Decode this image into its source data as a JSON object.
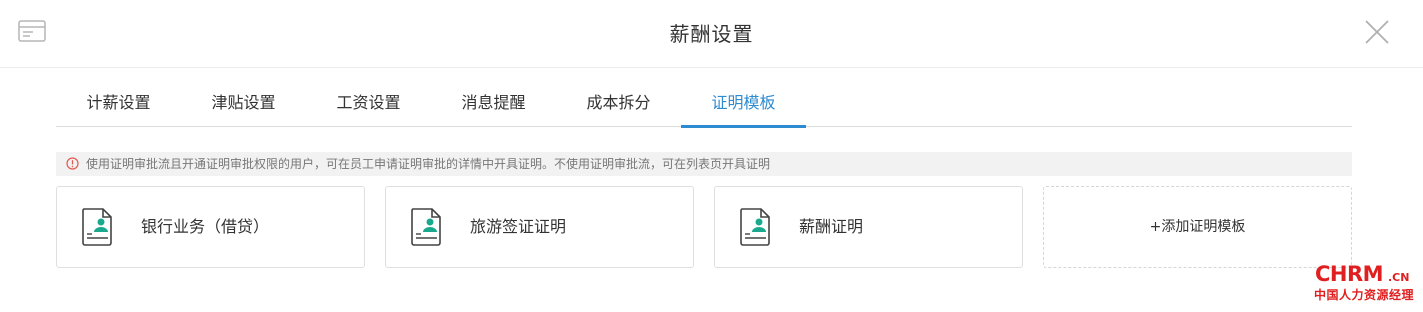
{
  "header": {
    "title": "薪酬设置",
    "left_icon": "card-icon",
    "close_icon": "close-icon"
  },
  "tabs": [
    {
      "label": "计薪设置"
    },
    {
      "label": "津贴设置"
    },
    {
      "label": "工资设置"
    },
    {
      "label": "消息提醒"
    },
    {
      "label": "成本拆分"
    },
    {
      "label": "证明模板",
      "active": true
    }
  ],
  "notice": {
    "icon": "info-icon",
    "text": "使用证明审批流且开通证明审批权限的用户，可在员工申请证明审批的详情中开具证明。不使用证明审批流，可在列表页开具证明"
  },
  "templates": [
    {
      "label": "银行业务（借贷）",
      "icon": "certificate-icon"
    },
    {
      "label": "旅游签证证明",
      "icon": "certificate-icon"
    },
    {
      "label": "薪酬证明",
      "icon": "certificate-icon"
    }
  ],
  "add_template_label": "+添加证明模板",
  "watermark": {
    "main": "CHRM",
    "suffix": ".CN",
    "sub": "中国人力资源经理"
  },
  "colors": {
    "accent": "#2e8bd0",
    "icon_green": "#1aa98d",
    "watermark": "#e02020"
  }
}
